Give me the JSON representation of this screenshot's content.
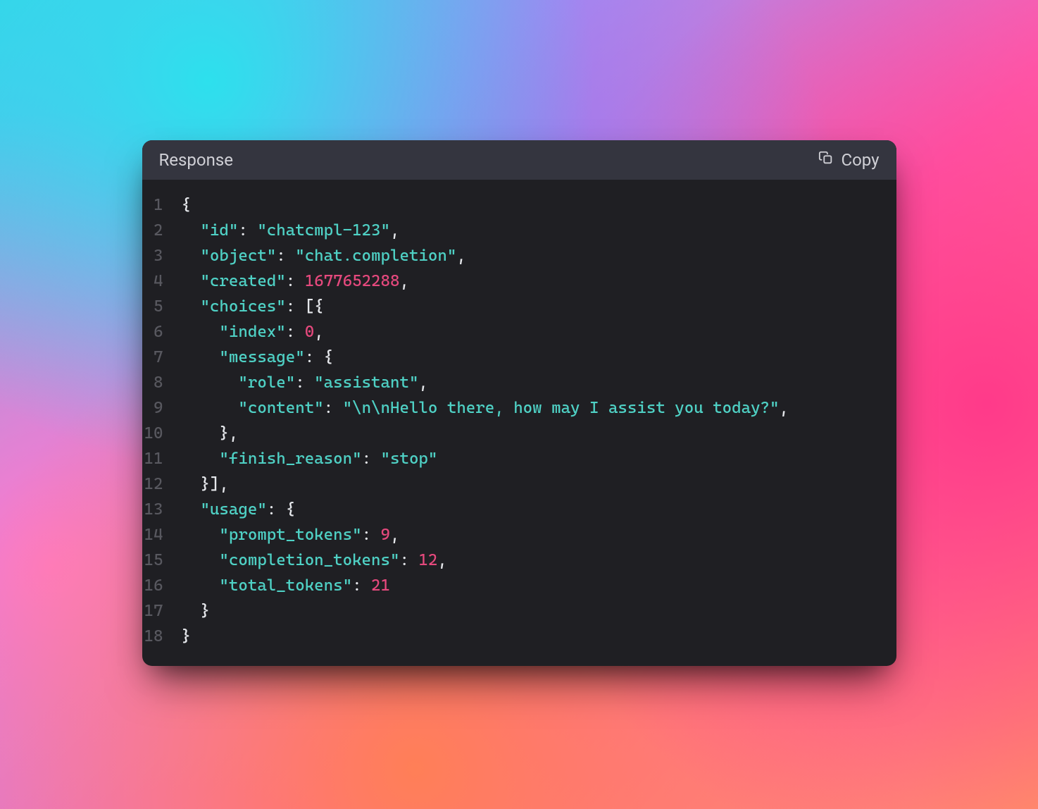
{
  "panel": {
    "title": "Response",
    "copy_label": "Copy"
  },
  "colors": {
    "key": "#4fd1c5",
    "string": "#4fd1c5",
    "number": "#e5497d",
    "punct": "#e5e7eb"
  },
  "code": {
    "indent": "  ",
    "lines": [
      {
        "n": 1,
        "segments": [
          {
            "t": "punct",
            "v": "{"
          }
        ]
      },
      {
        "n": 2,
        "segments": [
          {
            "t": "indent",
            "v": 1
          },
          {
            "t": "key",
            "v": "\"id\""
          },
          {
            "t": "punct",
            "v": ": "
          },
          {
            "t": "str",
            "v": "\"chatcmpl-123\""
          },
          {
            "t": "punct",
            "v": ","
          }
        ]
      },
      {
        "n": 3,
        "segments": [
          {
            "t": "indent",
            "v": 1
          },
          {
            "t": "key",
            "v": "\"object\""
          },
          {
            "t": "punct",
            "v": ": "
          },
          {
            "t": "str",
            "v": "\"chat.completion\""
          },
          {
            "t": "punct",
            "v": ","
          }
        ]
      },
      {
        "n": 4,
        "segments": [
          {
            "t": "indent",
            "v": 1
          },
          {
            "t": "key",
            "v": "\"created\""
          },
          {
            "t": "punct",
            "v": ": "
          },
          {
            "t": "num",
            "v": "1677652288"
          },
          {
            "t": "punct",
            "v": ","
          }
        ]
      },
      {
        "n": 5,
        "segments": [
          {
            "t": "indent",
            "v": 1
          },
          {
            "t": "key",
            "v": "\"choices\""
          },
          {
            "t": "punct",
            "v": ": [{"
          }
        ]
      },
      {
        "n": 6,
        "segments": [
          {
            "t": "indent",
            "v": 2
          },
          {
            "t": "key",
            "v": "\"index\""
          },
          {
            "t": "punct",
            "v": ": "
          },
          {
            "t": "num",
            "v": "0"
          },
          {
            "t": "punct",
            "v": ","
          }
        ]
      },
      {
        "n": 7,
        "segments": [
          {
            "t": "indent",
            "v": 2
          },
          {
            "t": "key",
            "v": "\"message\""
          },
          {
            "t": "punct",
            "v": ": {"
          }
        ]
      },
      {
        "n": 8,
        "segments": [
          {
            "t": "indent",
            "v": 3
          },
          {
            "t": "key",
            "v": "\"role\""
          },
          {
            "t": "punct",
            "v": ": "
          },
          {
            "t": "str",
            "v": "\"assistant\""
          },
          {
            "t": "punct",
            "v": ","
          }
        ]
      },
      {
        "n": 9,
        "segments": [
          {
            "t": "indent",
            "v": 3
          },
          {
            "t": "key",
            "v": "\"content\""
          },
          {
            "t": "punct",
            "v": ": "
          },
          {
            "t": "str",
            "v": "\"\\n\\nHello there, how may I assist you today?\""
          },
          {
            "t": "punct",
            "v": ","
          }
        ]
      },
      {
        "n": 10,
        "segments": [
          {
            "t": "indent",
            "v": 2
          },
          {
            "t": "punct",
            "v": "},"
          }
        ]
      },
      {
        "n": 11,
        "segments": [
          {
            "t": "indent",
            "v": 2
          },
          {
            "t": "key",
            "v": "\"finish_reason\""
          },
          {
            "t": "punct",
            "v": ": "
          },
          {
            "t": "str",
            "v": "\"stop\""
          }
        ]
      },
      {
        "n": 12,
        "segments": [
          {
            "t": "indent",
            "v": 1
          },
          {
            "t": "punct",
            "v": "}],"
          }
        ]
      },
      {
        "n": 13,
        "segments": [
          {
            "t": "indent",
            "v": 1
          },
          {
            "t": "key",
            "v": "\"usage\""
          },
          {
            "t": "punct",
            "v": ": {"
          }
        ]
      },
      {
        "n": 14,
        "segments": [
          {
            "t": "indent",
            "v": 2
          },
          {
            "t": "key",
            "v": "\"prompt_tokens\""
          },
          {
            "t": "punct",
            "v": ": "
          },
          {
            "t": "num",
            "v": "9"
          },
          {
            "t": "punct",
            "v": ","
          }
        ]
      },
      {
        "n": 15,
        "segments": [
          {
            "t": "indent",
            "v": 2
          },
          {
            "t": "key",
            "v": "\"completion_tokens\""
          },
          {
            "t": "punct",
            "v": ": "
          },
          {
            "t": "num",
            "v": "12"
          },
          {
            "t": "punct",
            "v": ","
          }
        ]
      },
      {
        "n": 16,
        "segments": [
          {
            "t": "indent",
            "v": 2
          },
          {
            "t": "key",
            "v": "\"total_tokens\""
          },
          {
            "t": "punct",
            "v": ": "
          },
          {
            "t": "num",
            "v": "21"
          }
        ]
      },
      {
        "n": 17,
        "segments": [
          {
            "t": "indent",
            "v": 1
          },
          {
            "t": "punct",
            "v": "}"
          }
        ]
      },
      {
        "n": 18,
        "segments": [
          {
            "t": "punct",
            "v": "}"
          }
        ]
      }
    ]
  }
}
